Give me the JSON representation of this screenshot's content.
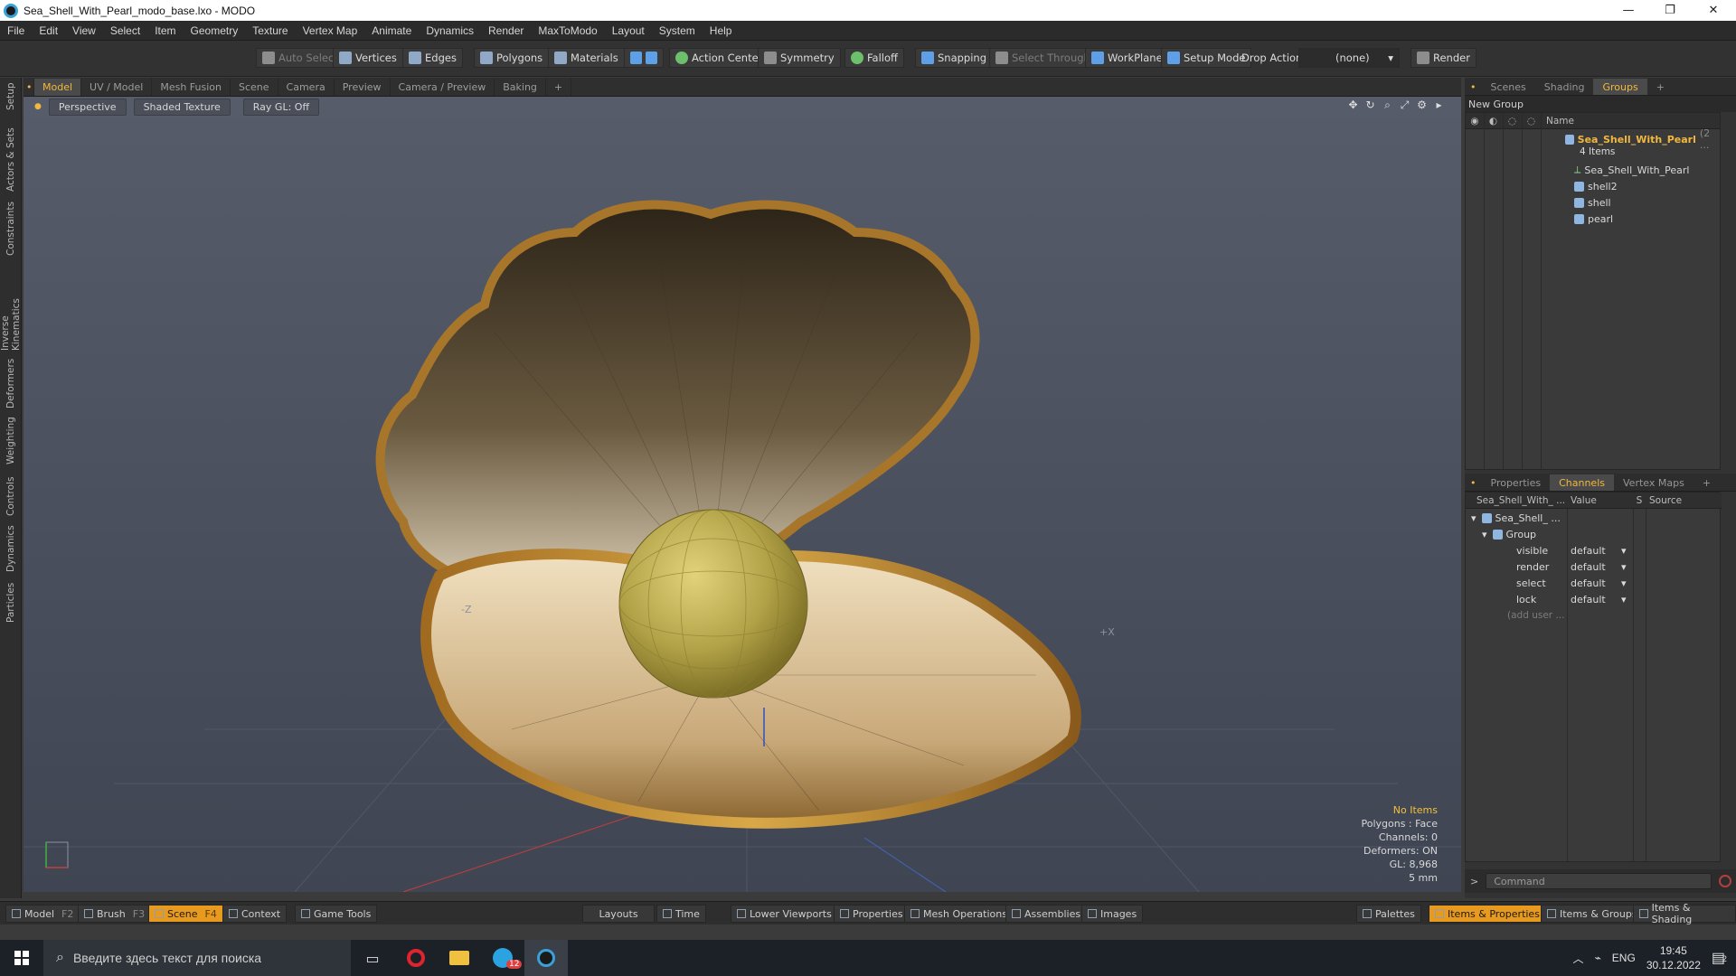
{
  "window": {
    "title": "Sea_Shell_With_Pearl_modo_base.lxo - MODO",
    "minimize": "—",
    "maximize": "❐",
    "close": "✕"
  },
  "menu": [
    "File",
    "Edit",
    "View",
    "Select",
    "Item",
    "Geometry",
    "Texture",
    "Vertex Map",
    "Animate",
    "Dynamics",
    "Render",
    "MaxToModo",
    "Layout",
    "System",
    "Help"
  ],
  "toolbar": {
    "auto_select": "Auto Select",
    "vertices": "Vertices",
    "edges": "Edges",
    "polygons": "Polygons",
    "materials": "Materials",
    "action_center": "Action Center",
    "symmetry": "Symmetry",
    "falloff": "Falloff",
    "snapping": "Snapping",
    "select_through": "Select Through",
    "workplane": "WorkPlane",
    "setup_mode": "Setup Mode",
    "drop_action": "Drop Action",
    "drop_value": "(none)",
    "render": "Render"
  },
  "left_tabs": [
    "Setup",
    "Actors & Sets",
    "Constraints",
    "Inverse Kinematics",
    "Deformers",
    "Weighting",
    "Controls",
    "Dynamics",
    "Particles"
  ],
  "viewport_tabs": [
    "Model",
    "UV / Model",
    "Mesh Fusion",
    "Scene",
    "Camera",
    "Preview",
    "Camera / Preview",
    "Baking",
    "+"
  ],
  "viewport": {
    "projection": "Perspective",
    "shading": "Shaded Texture",
    "raygl": "Ray GL: Off",
    "axis_neg_z": "-Z",
    "axis_pos_x": "+X",
    "stats": [
      "No Items",
      "Polygons : Face",
      "Channels: 0",
      "Deformers: ON",
      "GL: 8,968",
      "5 mm"
    ]
  },
  "right_tabs_top": [
    "Scenes",
    "Shading",
    "Groups",
    "+"
  ],
  "groups": {
    "new_group": "New Group",
    "col_name": "Name",
    "root": "Sea_Shell_With_Pearl",
    "root_suffix": "(2 ...",
    "root_count": "4 Items",
    "children": [
      "Sea_Shell_With_Pearl",
      "shell2",
      "shell",
      "pearl"
    ]
  },
  "right_tabs_bottom": [
    "Properties",
    "Channels",
    "Vertex Maps",
    "+"
  ],
  "channels": {
    "col_item": "Sea_Shell_With_ ...",
    "col_value": "Value",
    "col_s": "S",
    "col_source": "Source",
    "item": "Sea_Shell_ ...",
    "group": "Group",
    "rows": [
      {
        "name": "visible",
        "value": "default"
      },
      {
        "name": "render",
        "value": "default"
      },
      {
        "name": "select",
        "value": "default"
      },
      {
        "name": "lock",
        "value": "default"
      }
    ],
    "add_user": "(add user ..."
  },
  "command": {
    "placeholder": "Command",
    "prompt": ">"
  },
  "bottombar": {
    "model": "Model",
    "model_key": "F2",
    "brush": "Brush",
    "brush_key": "F3",
    "scene": "Scene",
    "scene_key": "F4",
    "context": "Context",
    "game_tools": "Game Tools",
    "layouts": "Layouts",
    "time": "Time",
    "lower_viewports": "Lower Viewports",
    "properties": "Properties",
    "mesh_operations": "Mesh Operations",
    "assemblies": "Assemblies",
    "images": "Images",
    "palettes": "Palettes",
    "items_properties": "Items & Properties",
    "items_groups": "Items & Groups",
    "items_shading": "Items & Shading"
  },
  "taskbar": {
    "search_placeholder": "Введите здесь текст для поиска",
    "telegram_badge": "12",
    "lang": "ENG",
    "time": "19:45",
    "date": "30.12.2022",
    "notif_count": "2"
  },
  "colors": {
    "accent": "#f0b840",
    "active_bar": "#e89a1e",
    "viewport_top": "#565c6a",
    "viewport_bottom": "#3f4552"
  }
}
